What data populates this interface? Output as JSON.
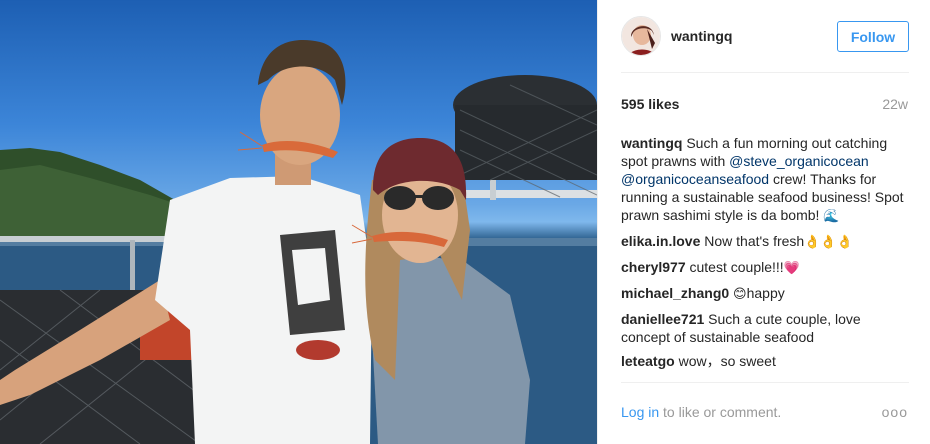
{
  "post": {
    "username": "wantingq",
    "follow_label": "Follow",
    "likes": "595 likes",
    "age": "22w",
    "caption": {
      "username": "wantingq",
      "text_1": "Such a fun morning out catching spot prawns with",
      "mention_1": "@steve_organicocean",
      "mention_2": "@organicoceanseafood",
      "text_2": "crew! Thanks for running a sustainable seafood business! Spot prawn sashimi style is da bomb!",
      "emoji": "🌊"
    },
    "comments": [
      {
        "username": "elika.in.love",
        "text": "Now that's fresh",
        "emoji": "👌👌👌"
      },
      {
        "username": "cheryl977",
        "text": "cutest couple!!!",
        "emoji": "💗"
      },
      {
        "username": "michael_zhang0",
        "emoji": "😊",
        "text": "happy"
      },
      {
        "username": "daniellee721",
        "text": "Such a cute couple, love concept of sustainable seafood",
        "emoji": ""
      },
      {
        "username": "leteatgo",
        "text": "wow，so sweet",
        "emoji": ""
      }
    ],
    "login_link": "Log in",
    "login_text": "to like or comment.",
    "more_label": "ooo"
  },
  "icons": {
    "avatar": "user-avatar",
    "more": "more-options-icon"
  },
  "colors": {
    "link": "#3897f0",
    "mention": "#003569",
    "muted": "#999999",
    "text": "#262626"
  }
}
